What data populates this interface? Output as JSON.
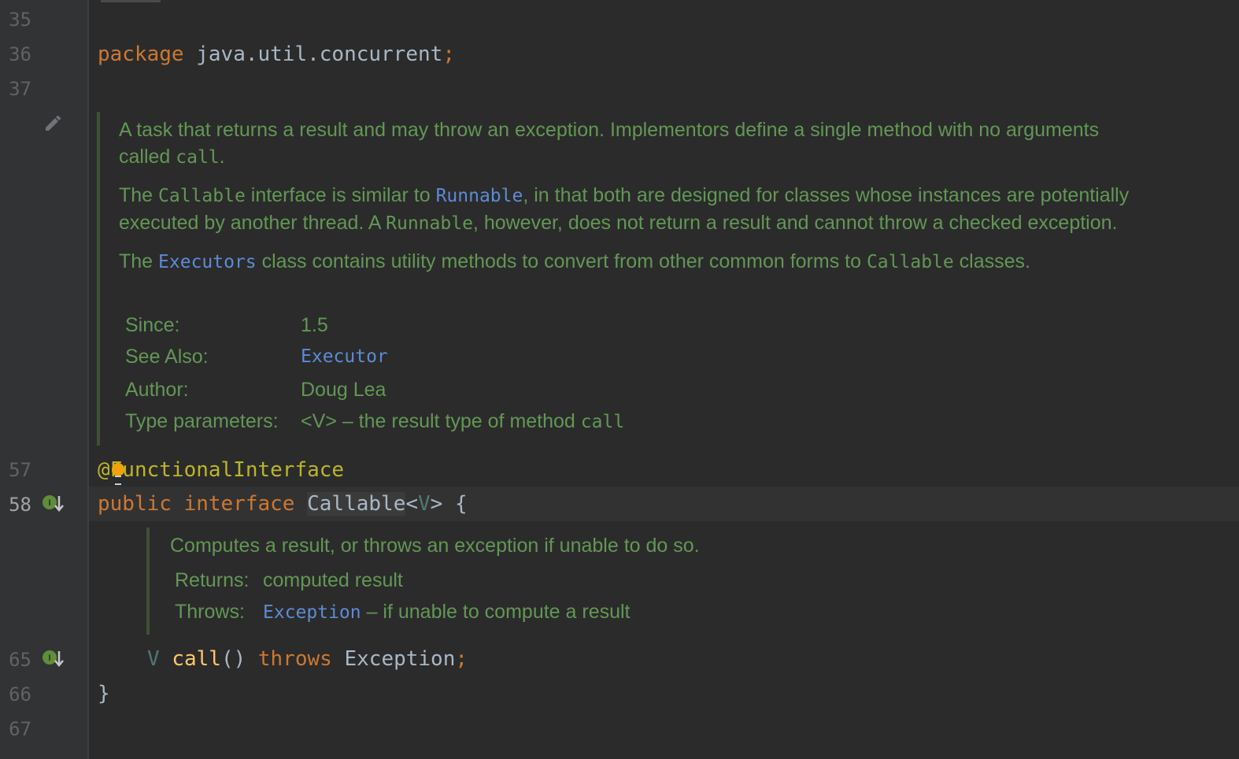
{
  "line_numbers": [
    {
      "n": "35"
    },
    {
      "n": "36"
    },
    {
      "n": "37"
    },
    {
      "n": "57"
    },
    {
      "n": "58"
    },
    {
      "n": "65"
    },
    {
      "n": "66"
    },
    {
      "n": "67"
    }
  ],
  "code": {
    "package_kw": "package",
    "package_name": " java.util.concurrent",
    "semicolon": ";",
    "annotation": "@FunctionalInterface",
    "public_kw": "public",
    "interface_kw": "interface",
    "class_name": "Callable",
    "lt": "<",
    "type_param": "V",
    "gt_brace": "> {",
    "method_type": "V",
    "method_name": "call",
    "method_parens": "()",
    "throws_kw": "throws",
    "exception": " Exception",
    "close_brace": "}"
  },
  "doc_interface": {
    "p1_text": "A task that returns a result and may throw an exception. Implementors define a single method with no arguments called ",
    "p1_code": "call",
    "p1_end": ".",
    "p2_a": "The ",
    "p2_code1": "Callable",
    "p2_b": " interface is similar to ",
    "p2_link": "Runnable",
    "p2_c": ", in that both are designed for classes whose instances are potentially executed by another thread. A ",
    "p2_code2": "Runnable",
    "p2_d": ", however, does not return a result and cannot throw a checked exception.",
    "p3_a": "The ",
    "p3_link": "Executors",
    "p3_b": " class contains utility methods to convert from other common forms to ",
    "p3_code": "Callable",
    "p3_c": " classes.",
    "since_label": "Since:",
    "since_value": "1.5",
    "see_also_label": "See Also:",
    "see_also_link": "Executor",
    "author_label": "Author:",
    "author_value": "Doug Lea",
    "type_params_label": "Type parameters:",
    "type_params_value": "<V> – the result type of method ",
    "type_params_code": "call"
  },
  "doc_method": {
    "summary": "Computes a result, or throws an exception if unable to do so.",
    "returns_label": "Returns:",
    "returns_value": "computed result",
    "throws_label": "Throws:",
    "throws_link": "Exception",
    "throws_value": " – if unable to compute a result"
  },
  "colors": {
    "background": "#2b2b2b",
    "keyword": "#cc7832",
    "doc_text": "#629755",
    "link": "#5c8bd6",
    "annotation": "#bbb529"
  }
}
